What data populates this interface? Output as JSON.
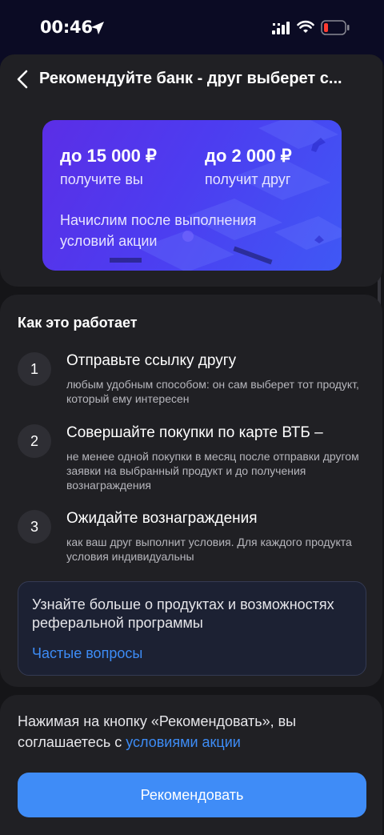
{
  "status_bar": {
    "time": "00:46",
    "battery_level": 0.15
  },
  "header": {
    "title": "Рекомендуйте банк - друг выберет с..."
  },
  "promo": {
    "you_amount": "до 15 000 ₽",
    "you_caption": "получите вы",
    "friend_amount": "до 2 000 ₽",
    "friend_caption": "получит друг",
    "note": "Начислим после выполнения условий акции"
  },
  "how": {
    "title": "Как это работает",
    "steps": [
      {
        "num": "1",
        "title": "Отправьте ссылку другу",
        "desc": "любым удобным способом: он сам выберет тот продукт, который ему интересен"
      },
      {
        "num": "2",
        "title": "Совершайте покупки по карте ВТБ –",
        "desc": "не менее одной покупки в месяц после отправки другом заявки на выбранный продукт и до получения вознаграждения"
      },
      {
        "num": "3",
        "title": "Ожидайте вознаграждения",
        "desc": "как ваш друг выполнит условия. Для каждого продукта условия индивидуальны"
      }
    ],
    "faq_text": "Узнайте больше о продуктах и возможностях реферальной программы",
    "faq_link": "Частые вопросы"
  },
  "footer": {
    "terms_text": "Нажимая на кнопку «Рекомендовать», вы соглашаетесь с ",
    "terms_link": "условиями акции",
    "cta_label": "Рекомендовать"
  },
  "colors": {
    "accent": "#3f8cf7",
    "link": "#3d8cf6",
    "promo_from": "#5b2ee6",
    "promo_to": "#3f58f5",
    "background": "#151518"
  }
}
